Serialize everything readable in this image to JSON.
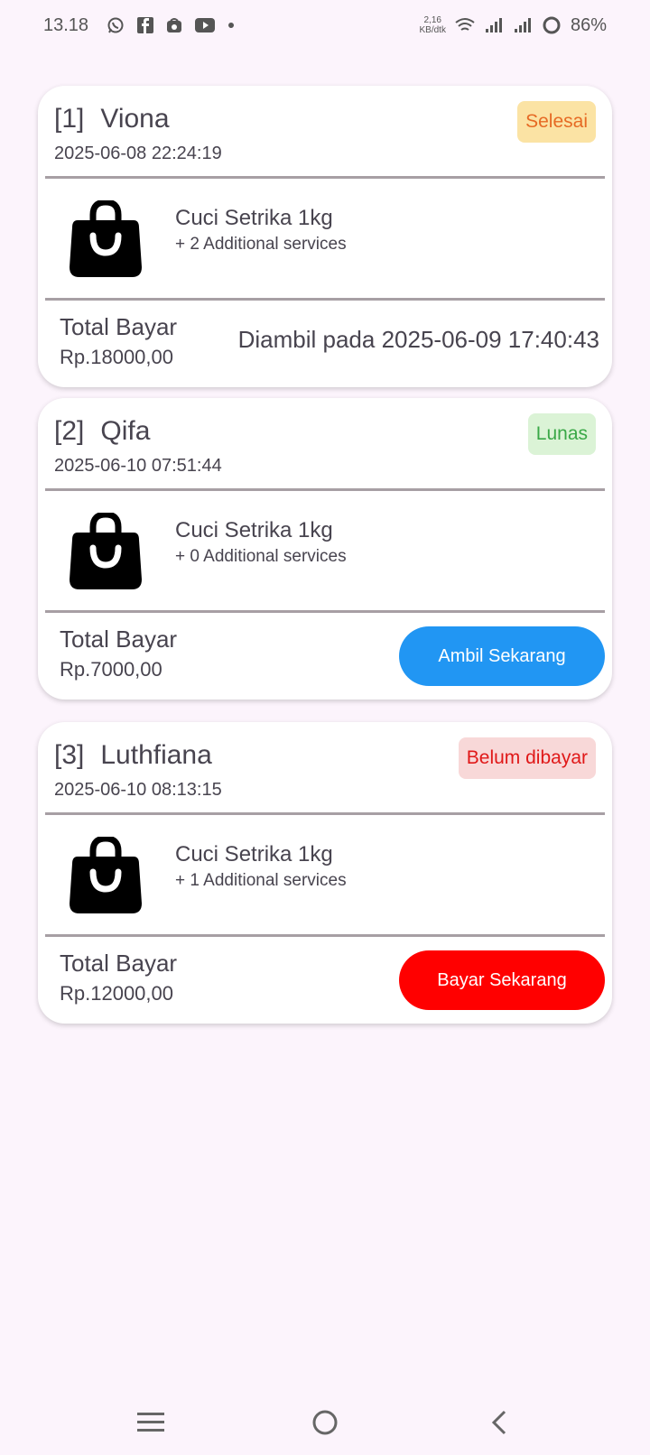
{
  "status_bar": {
    "time": "13.18",
    "net_speed_value": "2,16",
    "net_speed_unit": "KB/dtk",
    "battery": "86%",
    "notification_icons": [
      "whatsapp-icon",
      "facebook-icon",
      "shop-icon",
      "youtube-icon"
    ]
  },
  "orders": [
    {
      "index": "[1]",
      "name": "Viona",
      "date": "2025-06-08 22:24:19",
      "status": "Selesai",
      "status_bg": "#fbe3a4",
      "status_fg": "#e66a24",
      "service": "Cuci Setrika 1kg",
      "extra": "+ 2 Additional services",
      "total_label": "Total Bayar",
      "total": "Rp.18000,00",
      "picked": "Diambil pada 2025-06-09 17:40:43"
    },
    {
      "index": "[2]",
      "name": "Qifa",
      "date": "2025-06-10 07:51:44",
      "status": "Lunas",
      "status_bg": "#dbf3d6",
      "status_fg": "#3aa847",
      "service": "Cuci Setrika 1kg",
      "extra": "+ 0 Additional services",
      "total_label": "Total Bayar",
      "total": "Rp.7000,00",
      "action": "Ambil Sekarang",
      "action_color": "#2196f3"
    },
    {
      "index": "[3]",
      "name": "Luthfiana",
      "date": "2025-06-10 08:13:15",
      "status": "Belum dibayar",
      "status_bg": "#f8d8d8",
      "status_fg": "#e01818",
      "service": "Cuci Setrika 1kg",
      "extra": "+ 1 Additional services",
      "total_label": "Total Bayar",
      "total": "Rp.12000,00",
      "action": "Bayar Sekarang",
      "action_color": "#ff0000"
    }
  ],
  "nav": [
    "menu-icon",
    "home-icon",
    "back-icon"
  ]
}
